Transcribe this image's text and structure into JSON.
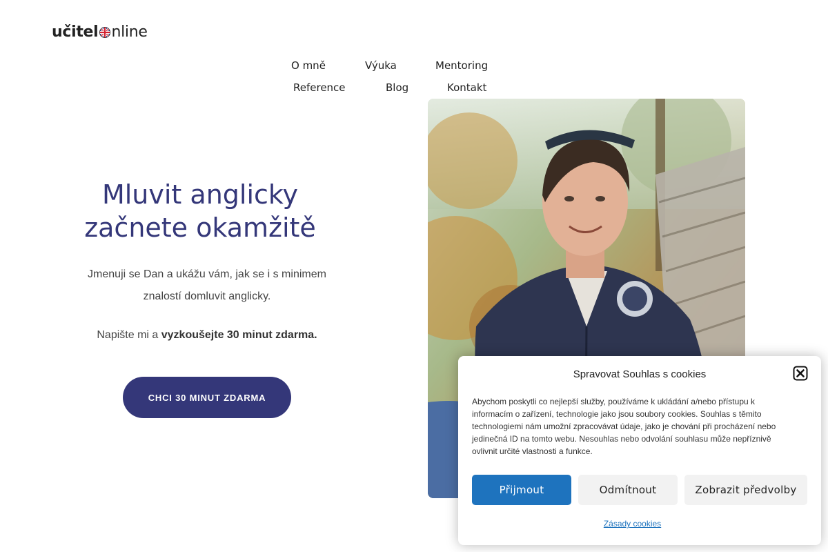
{
  "logo": {
    "part1": "učitel",
    "part2": "nline"
  },
  "nav": {
    "row1": [
      "O mně",
      "Výuka",
      "Mentoring"
    ],
    "row2": [
      "Reference",
      "Blog",
      "Kontakt"
    ]
  },
  "hero": {
    "title_line1": "Mluvit anglicky",
    "title_line2": "začnete okamžitě",
    "text": "Jmenuji se Dan a ukážu vám, jak se i s minimem znalostí domluvit anglicky.",
    "cta_text_plain": "Napište mi a ",
    "cta_text_bold": "vyzkoušejte 30 minut zdarma.",
    "cta_button": "CHCI 30 MINUT ZDARMA"
  },
  "colors": {
    "brand": "#343779",
    "accept": "#1e73be"
  },
  "cookie": {
    "title": "Spravovat Souhlas s cookies",
    "body": "Abychom poskytli co nejlepší služby, používáme k ukládání a/nebo přístupu k informacím o zařízení, technologie jako jsou soubory cookies. Souhlas s těmito technologiemi nám umožní zpracovávat údaje, jako je chování při procházení nebo jedinečná ID na tomto webu. Nesouhlas nebo odvolání souhlasu může nepříznivě ovlivnit určité vlastnosti a funkce.",
    "accept": "Přijmout",
    "deny": "Odmítnout",
    "prefs": "Zobrazit předvolby",
    "policy_link": "Zásady cookies"
  }
}
